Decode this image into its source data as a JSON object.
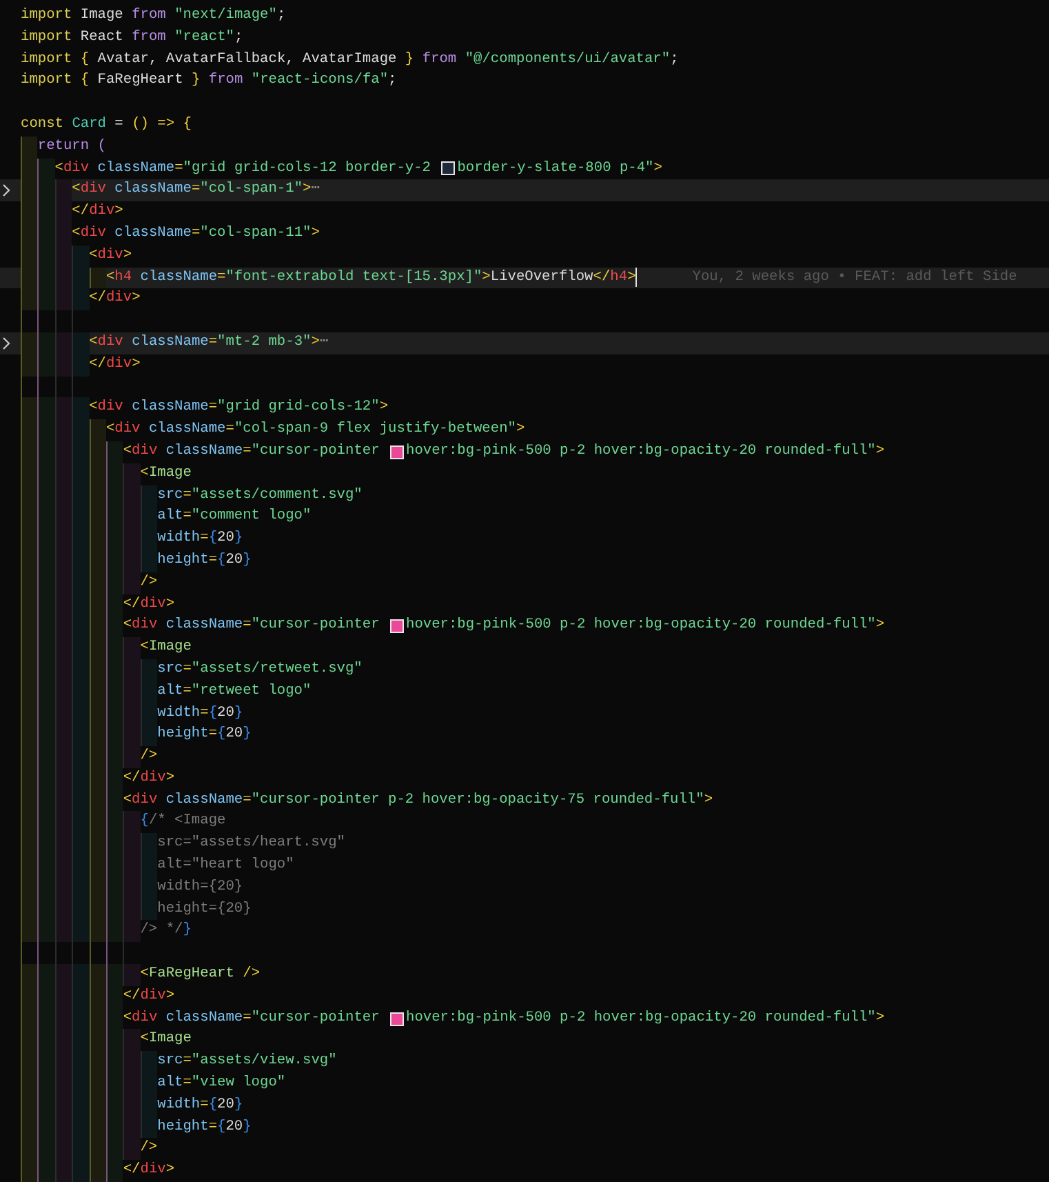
{
  "editor": {
    "lines": [
      {
        "kind": "code",
        "tokens": [
          {
            "kind": "keyword",
            "text": "import"
          },
          {
            "kind": "plain",
            "text": " Image "
          },
          {
            "kind": "control",
            "text": "from "
          },
          {
            "kind": "string",
            "text": "\"next/image\""
          },
          {
            "kind": "plain",
            "text": ";"
          }
        ]
      },
      {
        "kind": "code",
        "tokens": [
          {
            "kind": "keyword",
            "text": "import"
          },
          {
            "kind": "plain",
            "text": " React "
          },
          {
            "kind": "control",
            "text": "from "
          },
          {
            "kind": "string",
            "text": "\"react\""
          },
          {
            "kind": "plain",
            "text": ";"
          }
        ]
      },
      {
        "kind": "code",
        "tokens": [
          {
            "kind": "keyword",
            "text": "import "
          },
          {
            "kind": "punct",
            "text": "{"
          },
          {
            "kind": "plain",
            "text": " Avatar, AvatarFallback, AvatarImage "
          },
          {
            "kind": "punct",
            "text": "} "
          },
          {
            "kind": "control",
            "text": "from "
          },
          {
            "kind": "string",
            "text": "\"@/components/ui/avatar\""
          },
          {
            "kind": "plain",
            "text": ";"
          }
        ]
      },
      {
        "kind": "code",
        "tokens": [
          {
            "kind": "keyword",
            "text": "import "
          },
          {
            "kind": "punct",
            "text": "{"
          },
          {
            "kind": "plain",
            "text": " FaRegHeart "
          },
          {
            "kind": "punct",
            "text": "} "
          },
          {
            "kind": "control",
            "text": "from "
          },
          {
            "kind": "string",
            "text": "\"react-icons/fa\""
          },
          {
            "kind": "plain",
            "text": ";"
          }
        ]
      },
      {
        "kind": "blank"
      },
      {
        "kind": "code",
        "tokens": [
          {
            "kind": "keyword",
            "text": "const "
          },
          {
            "kind": "func",
            "text": "Card"
          },
          {
            "kind": "plain",
            "text": " = "
          },
          {
            "kind": "punct",
            "text": "() => {"
          }
        ]
      },
      {
        "kind": "code",
        "tokens": [
          {
            "kind": "control",
            "text": "  return ("
          }
        ]
      },
      {
        "kind": "code",
        "tokens": [
          {
            "kind": "punct",
            "text": "    <"
          },
          {
            "kind": "tag",
            "text": "div "
          },
          {
            "kind": "attr",
            "text": "className"
          },
          {
            "kind": "punct",
            "text": "="
          },
          {
            "kind": "string",
            "text": "\"grid grid-cols-12 border-y-2 "
          },
          {
            "kind": "swatch",
            "color": "#1e293b"
          },
          {
            "kind": "string",
            "text": "border-y-slate-800 p-4\""
          },
          {
            "kind": "punct",
            "text": ">"
          }
        ]
      },
      {
        "kind": "code",
        "folded": true,
        "tokens": [
          {
            "kind": "punct",
            "text": "      <"
          },
          {
            "kind": "tag",
            "text": "div "
          },
          {
            "kind": "attr",
            "text": "className"
          },
          {
            "kind": "punct",
            "text": "="
          },
          {
            "kind": "string",
            "text": "\"col-span-1\""
          },
          {
            "kind": "punct",
            "text": ">"
          },
          {
            "kind": "fold",
            "text": "⋯"
          }
        ]
      },
      {
        "kind": "code",
        "tokens": [
          {
            "kind": "punct",
            "text": "      </"
          },
          {
            "kind": "tag",
            "text": "div"
          },
          {
            "kind": "punct",
            "text": ">"
          }
        ]
      },
      {
        "kind": "code",
        "tokens": [
          {
            "kind": "punct",
            "text": "      <"
          },
          {
            "kind": "tag",
            "text": "div "
          },
          {
            "kind": "attr",
            "text": "className"
          },
          {
            "kind": "punct",
            "text": "="
          },
          {
            "kind": "string",
            "text": "\"col-span-11\""
          },
          {
            "kind": "punct",
            "text": ">"
          }
        ]
      },
      {
        "kind": "code",
        "tokens": [
          {
            "kind": "punct",
            "text": "        <"
          },
          {
            "kind": "tag",
            "text": "div"
          },
          {
            "kind": "punct",
            "text": ">"
          }
        ]
      },
      {
        "kind": "code",
        "current": true,
        "tokens": [
          {
            "kind": "punct",
            "text": "          <"
          },
          {
            "kind": "tag",
            "text": "h4 "
          },
          {
            "kind": "attr",
            "text": "className"
          },
          {
            "kind": "punct",
            "text": "="
          },
          {
            "kind": "string",
            "text": "\"font-extrabold text-[15.3px]\""
          },
          {
            "kind": "punct",
            "text": ">"
          },
          {
            "kind": "plain",
            "text": "LiveOverflow"
          },
          {
            "kind": "punct",
            "text": "</"
          },
          {
            "kind": "tag",
            "text": "h4"
          },
          {
            "kind": "punct",
            "text": ">"
          },
          {
            "kind": "blame",
            "text": "You, 2 weeks ago • FEAT: add left Side"
          }
        ]
      },
      {
        "kind": "code",
        "tokens": [
          {
            "kind": "punct",
            "text": "        </"
          },
          {
            "kind": "tag",
            "text": "div"
          },
          {
            "kind": "punct",
            "text": ">"
          }
        ]
      },
      {
        "kind": "blank"
      },
      {
        "kind": "code",
        "folded": true,
        "tokens": [
          {
            "kind": "punct",
            "text": "        <"
          },
          {
            "kind": "tag",
            "text": "div "
          },
          {
            "kind": "attr",
            "text": "className"
          },
          {
            "kind": "punct",
            "text": "="
          },
          {
            "kind": "string",
            "text": "\"mt-2 mb-3\""
          },
          {
            "kind": "punct",
            "text": ">"
          },
          {
            "kind": "fold",
            "text": "⋯"
          }
        ]
      },
      {
        "kind": "code",
        "tokens": [
          {
            "kind": "punct",
            "text": "        </"
          },
          {
            "kind": "tag",
            "text": "div"
          },
          {
            "kind": "punct",
            "text": ">"
          }
        ]
      },
      {
        "kind": "blank"
      },
      {
        "kind": "code",
        "tokens": [
          {
            "kind": "punct",
            "text": "        <"
          },
          {
            "kind": "tag",
            "text": "div "
          },
          {
            "kind": "attr",
            "text": "className"
          },
          {
            "kind": "punct",
            "text": "="
          },
          {
            "kind": "string",
            "text": "\"grid grid-cols-12\""
          },
          {
            "kind": "punct",
            "text": ">"
          }
        ]
      },
      {
        "kind": "code",
        "tokens": [
          {
            "kind": "punct",
            "text": "          <"
          },
          {
            "kind": "tag",
            "text": "div "
          },
          {
            "kind": "attr",
            "text": "className"
          },
          {
            "kind": "punct",
            "text": "="
          },
          {
            "kind": "string",
            "text": "\"col-span-9 flex justify-between\""
          },
          {
            "kind": "punct",
            "text": ">"
          }
        ]
      },
      {
        "kind": "code",
        "tokens": [
          {
            "kind": "punct",
            "text": "            <"
          },
          {
            "kind": "tag",
            "text": "div "
          },
          {
            "kind": "attr",
            "text": "className"
          },
          {
            "kind": "punct",
            "text": "="
          },
          {
            "kind": "string",
            "text": "\"cursor-pointer "
          },
          {
            "kind": "swatch",
            "color": "#ec4899"
          },
          {
            "kind": "string",
            "text": "hover:bg-pink-500 p-2 hover:bg-opacity-20 rounded-full\""
          },
          {
            "kind": "punct",
            "text": ">"
          }
        ]
      },
      {
        "kind": "code",
        "tokens": [
          {
            "kind": "punct",
            "text": "              <"
          },
          {
            "kind": "component",
            "text": "Image"
          }
        ]
      },
      {
        "kind": "code",
        "tokens": [
          {
            "kind": "attr",
            "text": "                src"
          },
          {
            "kind": "punct",
            "text": "="
          },
          {
            "kind": "string",
            "text": "\"assets/comment.svg\""
          }
        ]
      },
      {
        "kind": "code",
        "tokens": [
          {
            "kind": "attr",
            "text": "                alt"
          },
          {
            "kind": "punct",
            "text": "="
          },
          {
            "kind": "string",
            "text": "\"comment logo\""
          }
        ]
      },
      {
        "kind": "code",
        "tokens": [
          {
            "kind": "attr",
            "text": "                width"
          },
          {
            "kind": "punct",
            "text": "="
          },
          {
            "kind": "brace",
            "text": "{"
          },
          {
            "kind": "number",
            "text": "20"
          },
          {
            "kind": "brace",
            "text": "}"
          }
        ]
      },
      {
        "kind": "code",
        "tokens": [
          {
            "kind": "attr",
            "text": "                height"
          },
          {
            "kind": "punct",
            "text": "="
          },
          {
            "kind": "brace",
            "text": "{"
          },
          {
            "kind": "number",
            "text": "20"
          },
          {
            "kind": "brace",
            "text": "}"
          }
        ]
      },
      {
        "kind": "code",
        "tokens": [
          {
            "kind": "punct",
            "text": "              />"
          }
        ]
      },
      {
        "kind": "code",
        "tokens": [
          {
            "kind": "punct",
            "text": "            </"
          },
          {
            "kind": "tag",
            "text": "div"
          },
          {
            "kind": "punct",
            "text": ">"
          }
        ]
      },
      {
        "kind": "code",
        "tokens": [
          {
            "kind": "punct",
            "text": "            <"
          },
          {
            "kind": "tag",
            "text": "div "
          },
          {
            "kind": "attr",
            "text": "className"
          },
          {
            "kind": "punct",
            "text": "="
          },
          {
            "kind": "string",
            "text": "\"cursor-pointer "
          },
          {
            "kind": "swatch",
            "color": "#ec4899"
          },
          {
            "kind": "string",
            "text": "hover:bg-pink-500 p-2 hover:bg-opacity-20 rounded-full\""
          },
          {
            "kind": "punct",
            "text": ">"
          }
        ]
      },
      {
        "kind": "code",
        "tokens": [
          {
            "kind": "punct",
            "text": "              <"
          },
          {
            "kind": "component",
            "text": "Image"
          }
        ]
      },
      {
        "kind": "code",
        "tokens": [
          {
            "kind": "attr",
            "text": "                src"
          },
          {
            "kind": "punct",
            "text": "="
          },
          {
            "kind": "string",
            "text": "\"assets/retweet.svg\""
          }
        ]
      },
      {
        "kind": "code",
        "tokens": [
          {
            "kind": "attr",
            "text": "                alt"
          },
          {
            "kind": "punct",
            "text": "="
          },
          {
            "kind": "string",
            "text": "\"retweet logo\""
          }
        ]
      },
      {
        "kind": "code",
        "tokens": [
          {
            "kind": "attr",
            "text": "                width"
          },
          {
            "kind": "punct",
            "text": "="
          },
          {
            "kind": "brace",
            "text": "{"
          },
          {
            "kind": "number",
            "text": "20"
          },
          {
            "kind": "brace",
            "text": "}"
          }
        ]
      },
      {
        "kind": "code",
        "tokens": [
          {
            "kind": "attr",
            "text": "                height"
          },
          {
            "kind": "punct",
            "text": "="
          },
          {
            "kind": "brace",
            "text": "{"
          },
          {
            "kind": "number",
            "text": "20"
          },
          {
            "kind": "brace",
            "text": "}"
          }
        ]
      },
      {
        "kind": "code",
        "tokens": [
          {
            "kind": "punct",
            "text": "              />"
          }
        ]
      },
      {
        "kind": "code",
        "tokens": [
          {
            "kind": "punct",
            "text": "            </"
          },
          {
            "kind": "tag",
            "text": "div"
          },
          {
            "kind": "punct",
            "text": ">"
          }
        ]
      },
      {
        "kind": "code",
        "tokens": [
          {
            "kind": "punct",
            "text": "            <"
          },
          {
            "kind": "tag",
            "text": "div "
          },
          {
            "kind": "attr",
            "text": "className"
          },
          {
            "kind": "punct",
            "text": "="
          },
          {
            "kind": "string",
            "text": "\"cursor-pointer p-2 hover:bg-opacity-75 rounded-full\""
          },
          {
            "kind": "punct",
            "text": ">"
          }
        ]
      },
      {
        "kind": "code",
        "tokens": [
          {
            "kind": "brace",
            "text": "              {"
          },
          {
            "kind": "comment",
            "text": "/* <Image"
          }
        ]
      },
      {
        "kind": "code",
        "tokens": [
          {
            "kind": "comment",
            "text": "                src=\"assets/heart.svg\""
          }
        ]
      },
      {
        "kind": "code",
        "tokens": [
          {
            "kind": "comment",
            "text": "                alt=\"heart logo\""
          }
        ]
      },
      {
        "kind": "code",
        "tokens": [
          {
            "kind": "comment",
            "text": "                width={20}"
          }
        ]
      },
      {
        "kind": "code",
        "tokens": [
          {
            "kind": "comment",
            "text": "                height={20}"
          }
        ]
      },
      {
        "kind": "code",
        "tokens": [
          {
            "kind": "comment",
            "text": "              /> */"
          },
          {
            "kind": "brace",
            "text": "}"
          }
        ]
      },
      {
        "kind": "blank"
      },
      {
        "kind": "code",
        "tokens": [
          {
            "kind": "punct",
            "text": "              <"
          },
          {
            "kind": "component",
            "text": "FaRegHeart "
          },
          {
            "kind": "punct",
            "text": "/>"
          }
        ]
      },
      {
        "kind": "code",
        "tokens": [
          {
            "kind": "punct",
            "text": "            </"
          },
          {
            "kind": "tag",
            "text": "div"
          },
          {
            "kind": "punct",
            "text": ">"
          }
        ]
      },
      {
        "kind": "code",
        "tokens": [
          {
            "kind": "punct",
            "text": "            <"
          },
          {
            "kind": "tag",
            "text": "div "
          },
          {
            "kind": "attr",
            "text": "className"
          },
          {
            "kind": "punct",
            "text": "="
          },
          {
            "kind": "string",
            "text": "\"cursor-pointer "
          },
          {
            "kind": "swatch",
            "color": "#ec4899"
          },
          {
            "kind": "string",
            "text": "hover:bg-pink-500 p-2 hover:bg-opacity-20 rounded-full\""
          },
          {
            "kind": "punct",
            "text": ">"
          }
        ]
      },
      {
        "kind": "code",
        "tokens": [
          {
            "kind": "punct",
            "text": "              <"
          },
          {
            "kind": "component",
            "text": "Image"
          }
        ]
      },
      {
        "kind": "code",
        "tokens": [
          {
            "kind": "attr",
            "text": "                src"
          },
          {
            "kind": "punct",
            "text": "="
          },
          {
            "kind": "string",
            "text": "\"assets/view.svg\""
          }
        ]
      },
      {
        "kind": "code",
        "tokens": [
          {
            "kind": "attr",
            "text": "                alt"
          },
          {
            "kind": "punct",
            "text": "="
          },
          {
            "kind": "string",
            "text": "\"view logo\""
          }
        ]
      },
      {
        "kind": "code",
        "tokens": [
          {
            "kind": "attr",
            "text": "                width"
          },
          {
            "kind": "punct",
            "text": "="
          },
          {
            "kind": "brace",
            "text": "{"
          },
          {
            "kind": "number",
            "text": "20"
          },
          {
            "kind": "brace",
            "text": "}"
          }
        ]
      },
      {
        "kind": "code",
        "tokens": [
          {
            "kind": "attr",
            "text": "                height"
          },
          {
            "kind": "punct",
            "text": "="
          },
          {
            "kind": "brace",
            "text": "{"
          },
          {
            "kind": "number",
            "text": "20"
          },
          {
            "kind": "brace",
            "text": "}"
          }
        ]
      },
      {
        "kind": "code",
        "tokens": [
          {
            "kind": "punct",
            "text": "              />"
          }
        ]
      },
      {
        "kind": "code",
        "tokens": [
          {
            "kind": "punct",
            "text": "            </"
          },
          {
            "kind": "tag",
            "text": "div"
          },
          {
            "kind": "punct",
            "text": ">"
          }
        ]
      }
    ]
  }
}
